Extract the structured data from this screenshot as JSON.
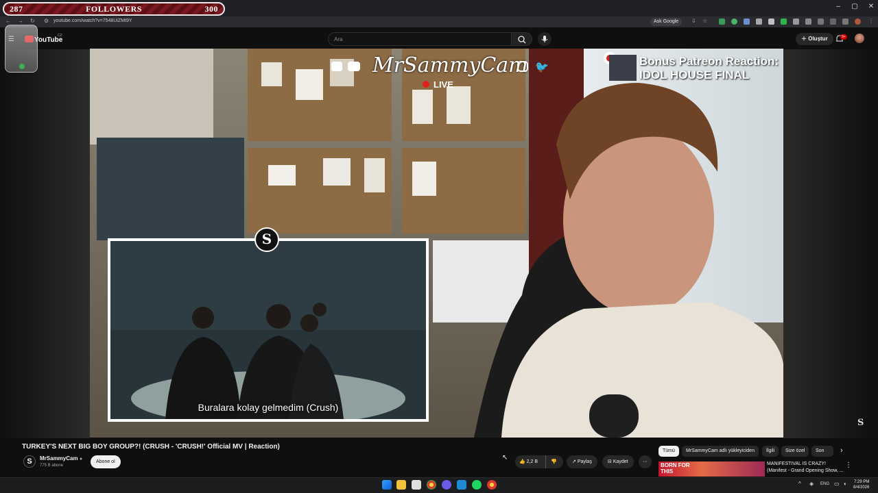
{
  "follower_bar": {
    "current": "287",
    "label": "FOLLOWERS",
    "goal": "300"
  },
  "browser": {
    "url": "youtube.com/watch?v=7548UiZMt9Y",
    "ask_google": "Ask Google"
  },
  "youtube": {
    "logo_text": "YouTube",
    "region": "CZ",
    "search_placeholder": "Ara",
    "create_label": "Oluştur",
    "notification_count": "9+"
  },
  "stream_overlay": {
    "channel": "MrSammyCam",
    "live": "LIVE",
    "bonus_title": "Bonus Patreon Reaction:",
    "bonus_sub": "IDOL HOUSE FINAL",
    "inset_badge": "S",
    "subtitle": "Buralara kolay gelmedim (Crush)"
  },
  "video": {
    "title": "TURKEY'S NEXT BIG BOY GROUP?! (CRUSH - 'CRUSH!' Official MV | Reaction)",
    "channel_name": "MrSammyCam",
    "subscribers": "775 B abone",
    "subscribe_label": "Abone ol",
    "likes": "2,2 B",
    "share_label": "Paylaş",
    "save_label": "Kaydet",
    "more_label": "⋯"
  },
  "chips": [
    "Tümü",
    "MrSammyCam adlı yükleyiciden",
    "İlgili",
    "Size özel",
    "Son yü"
  ],
  "recommendation": {
    "thumb_text_1": "BORN FOR",
    "thumb_text_2": "THIS",
    "title": "MANIFESTIVAL IS CRAZY! (Manifest - Grand Opening Show, ..."
  },
  "taskbar": {
    "lang": "ENG",
    "time": "7:29 PM",
    "date": "8/4/2026"
  },
  "colors": {
    "live_red": "#e0201c",
    "follower_bar": "#7a1820",
    "youtube_red": "#ff0000"
  }
}
